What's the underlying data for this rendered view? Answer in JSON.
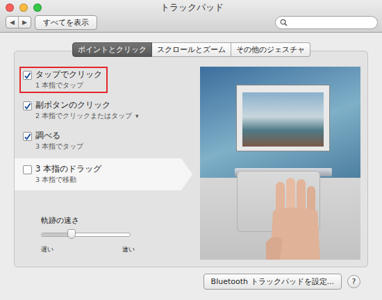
{
  "window": {
    "title": "トラックパッド"
  },
  "toolbar": {
    "nav": [
      "◀",
      "▶"
    ],
    "show_all": "すべてを表示"
  },
  "tabs": [
    {
      "label": "ポイントとクリック",
      "selected": true
    },
    {
      "label": "スクロールとズーム",
      "selected": false
    },
    {
      "label": "その他のジェスチャ",
      "selected": false
    }
  ],
  "options": [
    {
      "title": "タップでクリック",
      "subtitle": "1 本指でタップ",
      "checked": true,
      "selected": false,
      "annotated": true
    },
    {
      "title": "副ボタンのクリック",
      "subtitle": "2 本指でクリックまたはタップ",
      "menu": "▾",
      "checked": true,
      "selected": false,
      "annotated": false
    },
    {
      "title": "調べる",
      "subtitle": "3 本指でタップ",
      "checked": true,
      "selected": false,
      "annotated": false
    },
    {
      "title": "3 本指のドラッグ",
      "subtitle": "3 本指で移動",
      "checked": false,
      "selected": true,
      "annotated": false
    }
  ],
  "slider": {
    "label": "軌跡の速さ",
    "level": 0.34,
    "min_label": "遅い",
    "max_label": "速い"
  },
  "buttons": [
    {
      "label": "Bluetooth トラックパッドを設定..."
    }
  ],
  "help": "?"
}
